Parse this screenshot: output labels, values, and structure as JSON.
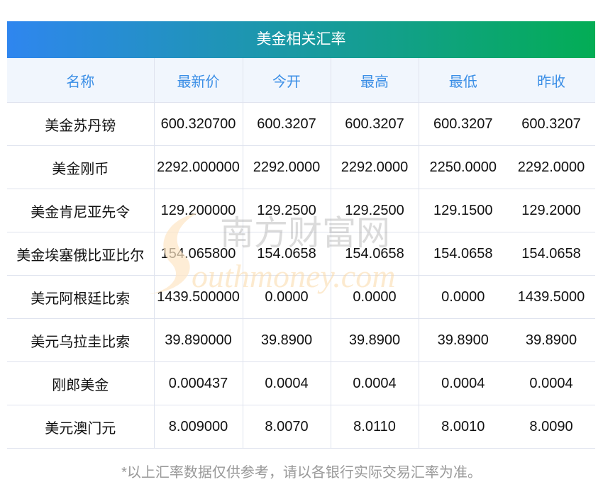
{
  "title": "美金相关汇率",
  "columns": [
    "名称",
    "最新价",
    "今开",
    "最高",
    "最低",
    "昨收"
  ],
  "rows": [
    [
      "美金苏丹镑",
      "600.320700",
      "600.3207",
      "600.3207",
      "600.3207",
      "600.3207"
    ],
    [
      "美金刚币",
      "2292.000000",
      "2292.0000",
      "2292.0000",
      "2250.0000",
      "2292.0000"
    ],
    [
      "美金肯尼亚先令",
      "129.200000",
      "129.2500",
      "129.2500",
      "129.1500",
      "129.2000"
    ],
    [
      "美金埃塞俄比亚比尔",
      "154.065800",
      "154.0658",
      "154.0658",
      "154.0658",
      "154.0658"
    ],
    [
      "美元阿根廷比索",
      "1439.500000",
      "0.0000",
      "0.0000",
      "0.0000",
      "1439.5000"
    ],
    [
      "美元乌拉圭比索",
      "39.890000",
      "39.8900",
      "39.8900",
      "39.8900",
      "39.8900"
    ],
    [
      "刚郎美金",
      "0.000437",
      "0.0004",
      "0.0004",
      "0.0004",
      "0.0004"
    ],
    [
      "美元澳门元",
      "8.009000",
      "8.0070",
      "8.0110",
      "8.0010",
      "8.0090"
    ]
  ],
  "footer": "*以上汇率数据仅供参考，请以各银行实际交易汇率为准。",
  "watermark": {
    "cn": "南方财富网",
    "en": "outhmoney.com"
  }
}
